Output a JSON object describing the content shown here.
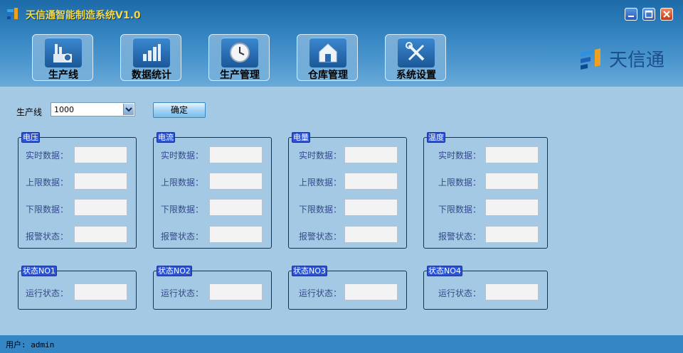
{
  "window": {
    "title": "天信通智能制造系统V1.0"
  },
  "nav": [
    {
      "label": "生产线",
      "icon": "factory-icon"
    },
    {
      "label": "数据统计",
      "icon": "bar-chart-icon"
    },
    {
      "label": "生产管理",
      "icon": "clock-icon"
    },
    {
      "label": "仓库管理",
      "icon": "warehouse-icon"
    },
    {
      "label": "系统设置",
      "icon": "tools-icon"
    }
  ],
  "brand": {
    "name": "天信通"
  },
  "toolbar": {
    "line_label": "生产线",
    "line_value": "1000",
    "confirm_label": "确定"
  },
  "groups": [
    {
      "title": "电压",
      "fields": [
        "实时数据：",
        "上限数据：",
        "下限数据：",
        "报警状态："
      ]
    },
    {
      "title": "电流",
      "fields": [
        "实时数据：",
        "上限数据：",
        "下限数据：",
        "报警状态："
      ]
    },
    {
      "title": "电量",
      "fields": [
        "实时数据：",
        "上限数据：",
        "下限数据：",
        "报警状态："
      ]
    },
    {
      "title": "温度",
      "fields": [
        "实时数据：",
        "上限数据：",
        "下限数据：",
        "报警状态："
      ]
    }
  ],
  "status_groups": [
    {
      "title": "状态NO1",
      "field": "运行状态："
    },
    {
      "title": "状态NO2",
      "field": "运行状态："
    },
    {
      "title": "状态NO3",
      "field": "运行状态："
    },
    {
      "title": "状态NO4",
      "field": "运行状态："
    }
  ],
  "statusbar": {
    "user_text": "用户: admin"
  },
  "colors": {
    "title_text": "#f4d84a",
    "header_bg": "#2f80bf",
    "content_bg": "#a4c9e5",
    "legend_bg": "#2a54d8",
    "label_text": "#34498c"
  }
}
